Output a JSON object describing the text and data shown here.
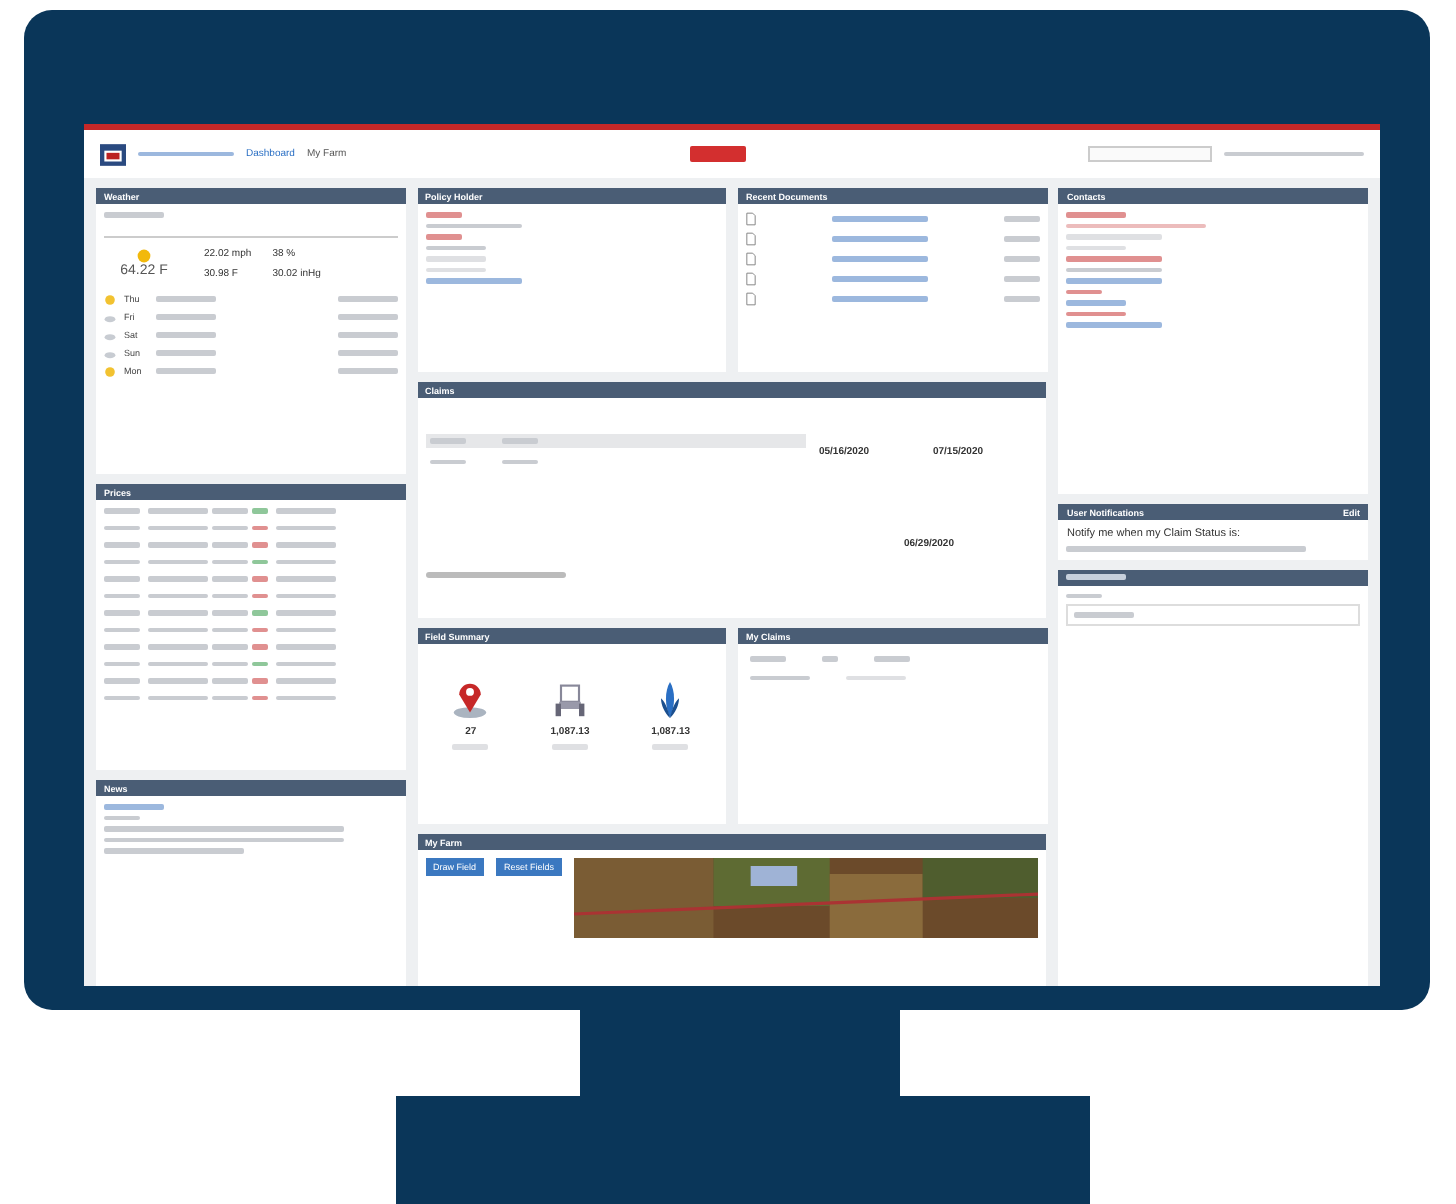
{
  "header": {
    "nav": [
      {
        "label": "Dashboard",
        "selected": true
      },
      {
        "label": "My Farm",
        "selected": false
      }
    ]
  },
  "weather": {
    "title": "Weather",
    "temperature": "64.22 F",
    "readings": [
      "22.02 mph",
      "38 %",
      "30.98 F",
      "30.02 inHg"
    ],
    "forecast": [
      {
        "day": "Thu",
        "kind": "sunny"
      },
      {
        "day": "Fri",
        "kind": "cloudy"
      },
      {
        "day": "Sat",
        "kind": "cloudy"
      },
      {
        "day": "Sun",
        "kind": "cloudy"
      },
      {
        "day": "Mon",
        "kind": "sunny"
      }
    ]
  },
  "prices": {
    "title": "Prices"
  },
  "news": {
    "title": "News"
  },
  "policy_holder": {
    "title": "Policy Holder"
  },
  "recent_documents": {
    "title": "Recent Documents"
  },
  "claims": {
    "title": "Claims",
    "dates": [
      "05/16/2020",
      "07/15/2020",
      "06/29/2020"
    ]
  },
  "field_summary": {
    "title": "Field Summary",
    "stats": [
      {
        "kind": "pin",
        "value": "27"
      },
      {
        "kind": "tractor",
        "value": "1,087.13"
      },
      {
        "kind": "corn",
        "value": "1,087.13"
      }
    ]
  },
  "my_claims": {
    "title": "My Claims"
  },
  "my_farm": {
    "title": "My Farm",
    "buttons": [
      "Draw Field",
      "Reset Fields"
    ]
  },
  "contacts": {
    "title": "Contacts"
  },
  "notifications": {
    "title": "User Notifications",
    "action": "Edit",
    "text": "Notify me when my Claim Status is:"
  }
}
